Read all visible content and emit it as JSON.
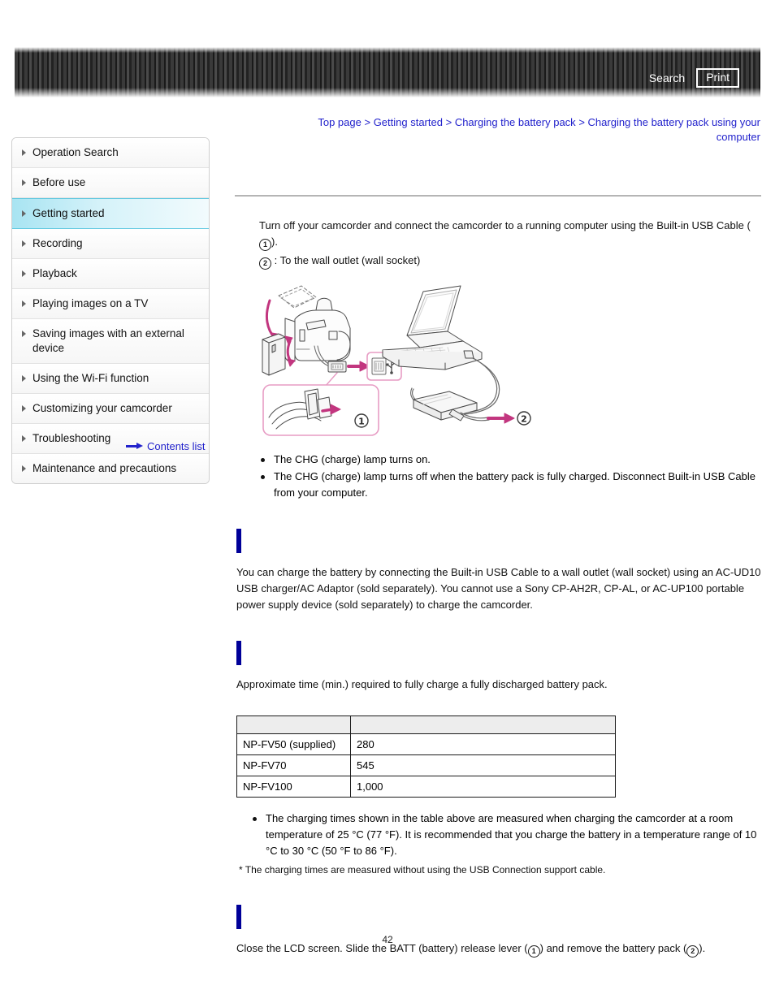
{
  "header": {
    "search_label": "Search",
    "print_label": "Print"
  },
  "breadcrumb": {
    "items": [
      "Top page",
      "Getting started",
      "Charging the battery pack",
      "Charging the battery pack using your computer"
    ],
    "separator": ">"
  },
  "sidebar": {
    "items": [
      {
        "label": "Operation Search",
        "active": false
      },
      {
        "label": "Before use",
        "active": false
      },
      {
        "label": "Getting started",
        "active": true
      },
      {
        "label": "Recording",
        "active": false
      },
      {
        "label": "Playback",
        "active": false
      },
      {
        "label": "Playing images on a TV",
        "active": false
      },
      {
        "label": "Saving images with an external device",
        "active": false
      },
      {
        "label": "Using the Wi-Fi function",
        "active": false
      },
      {
        "label": "Customizing your camcorder",
        "active": false
      },
      {
        "label": "Troubleshooting",
        "active": false
      },
      {
        "label": "Maintenance and precautions",
        "active": false
      }
    ],
    "contents_list_label": "Contents list"
  },
  "main": {
    "step_text_prefix": "Turn off your camcorder and connect the camcorder to a running computer using the Built-in USB Cable (",
    "step_text_suffix": ").",
    "badge_one": "1",
    "badge_two": "2",
    "wall_outlet_note": ": To the wall outlet (wall socket)",
    "bullets": [
      "The CHG (charge) lamp turns on.",
      "The CHG (charge) lamp turns off when the battery pack is fully charged. Disconnect Built-in USB Cable from your computer."
    ],
    "section_charging_wall": {
      "heading": "",
      "body": "You can charge the battery by connecting the Built-in USB Cable to a wall outlet (wall socket) using an AC-UD10 USB charger/AC Adaptor (sold separately). You cannot use a Sony CP-AH2R, CP-AL, or AC-UP100 portable power supply device (sold separately) to charge the camcorder."
    },
    "section_charging_time": {
      "heading": "",
      "body": "Approximate time (min.) required to fully charge a fully discharged battery pack.",
      "table": {
        "headers": [
          "",
          ""
        ],
        "rows": [
          [
            "NP-FV50 (supplied)",
            "280"
          ],
          [
            "NP-FV70",
            "545"
          ],
          [
            "NP-FV100",
            "1,000"
          ]
        ]
      },
      "bullets": [
        "The charging times shown in the table above are measured when charging the camcorder at a room temperature of 25 °C (77 °F). It is recommended that you charge the battery in a temperature range of 10 °C to 30 °C (50 °F to 86 °F)."
      ],
      "footnote": "* The charging times are measured without using the USB Connection support cable."
    },
    "section_remove_battery": {
      "heading": "",
      "text_part_1": "Close the LCD screen. Slide the BATT (battery) release lever (",
      "text_part_2": ") and remove the battery pack (",
      "text_part_3": ")."
    },
    "illustration_alt": "camcorder-usb-computer-diagram"
  },
  "footer": {
    "page_number": "42"
  },
  "colors": {
    "link_blue": "#2222cc",
    "section_bar_navy": "#000099",
    "active_nav_cyan": "#a8e4f2",
    "illustration_pink": "#c2367f"
  }
}
